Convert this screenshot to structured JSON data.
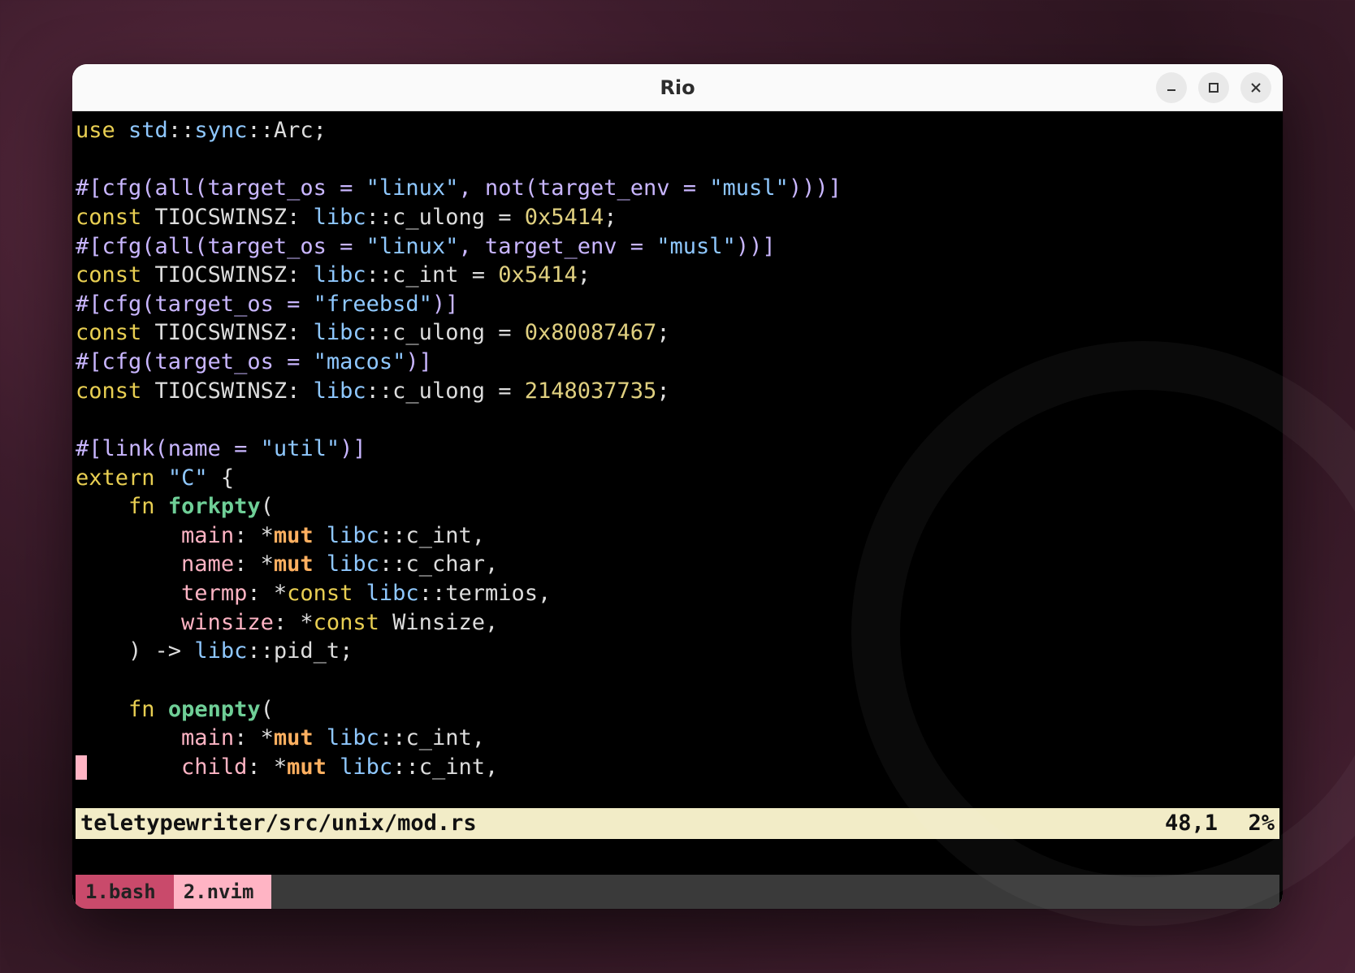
{
  "window": {
    "title": "Rio"
  },
  "status": {
    "file": "teletypewriter/src/unix/mod.rs",
    "pos": "48,1",
    "pct": "2%"
  },
  "tabs": [
    {
      "label": "1.bash",
      "active": false
    },
    {
      "label": "2.nvim",
      "active": true
    }
  ],
  "code": {
    "l1": {
      "use": "use",
      "path": "std",
      "sep1": "::",
      "sync": "sync",
      "sep2": "::",
      "arc": "Arc",
      "end": ";"
    },
    "l3": {
      "attr": "#[cfg(all(target_os = ",
      "s1": "\"linux\"",
      "mid": ", not(target_env = ",
      "s2": "\"musl\"",
      "tail": ")))]"
    },
    "l4": {
      "const": "const",
      "name": "TIOCSWINSZ",
      "colon": ": ",
      "libc": "libc",
      "sep": "::",
      "ty": "c_ulong",
      "eq": " = ",
      "val": "0x5414",
      "end": ";"
    },
    "l5": {
      "attr": "#[cfg(all(target_os = ",
      "s1": "\"linux\"",
      "mid": ", target_env = ",
      "s2": "\"musl\"",
      "tail": "))]"
    },
    "l6": {
      "const": "const",
      "name": "TIOCSWINSZ",
      "colon": ": ",
      "libc": "libc",
      "sep": "::",
      "ty": "c_int",
      "eq": " = ",
      "val": "0x5414",
      "end": ";"
    },
    "l7": {
      "attr": "#[cfg(target_os = ",
      "s1": "\"freebsd\"",
      "tail": ")]"
    },
    "l8": {
      "const": "const",
      "name": "TIOCSWINSZ",
      "colon": ": ",
      "libc": "libc",
      "sep": "::",
      "ty": "c_ulong",
      "eq": " = ",
      "val": "0x80087467",
      "end": ";"
    },
    "l9": {
      "attr": "#[cfg(target_os = ",
      "s1": "\"macos\"",
      "tail": ")]"
    },
    "l10": {
      "const": "const",
      "name": "TIOCSWINSZ",
      "colon": ": ",
      "libc": "libc",
      "sep": "::",
      "ty": "c_ulong",
      "eq": " = ",
      "val": "2148037735",
      "end": ";"
    },
    "l12": {
      "attr": "#[link(name = ",
      "s1": "\"util\"",
      "tail": ")]"
    },
    "l13": {
      "extern": "extern",
      "abi": "\"C\"",
      "brace": " {"
    },
    "l14": {
      "indent": "    ",
      "fn": "fn",
      "name": "forkpty",
      "paren": "("
    },
    "l15": {
      "indent": "        ",
      "arg": "main",
      "colon": ": ",
      "star": "*",
      "mut": "mut",
      "sp": " ",
      "libc": "libc",
      "sep": "::",
      "ty": "c_int",
      "end": ","
    },
    "l16": {
      "indent": "        ",
      "arg": "name",
      "colon": ": ",
      "star": "*",
      "mut": "mut",
      "sp": " ",
      "libc": "libc",
      "sep": "::",
      "ty": "c_char",
      "end": ","
    },
    "l17": {
      "indent": "        ",
      "arg": "termp",
      "colon": ": ",
      "star": "*",
      "const": "const",
      "sp": " ",
      "libc": "libc",
      "sep": "::",
      "ty": "termios",
      "end": ","
    },
    "l18": {
      "indent": "        ",
      "arg": "winsize",
      "colon": ": ",
      "star": "*",
      "const": "const",
      "sp": " ",
      "ty": "Winsize",
      "end": ","
    },
    "l19": {
      "indent": "    ",
      "close": ") -> ",
      "libc": "libc",
      "sep": "::",
      "ty": "pid_t",
      "end": ";"
    },
    "l21": {
      "indent": "    ",
      "fn": "fn",
      "name": "openpty",
      "paren": "("
    },
    "l22": {
      "indent": "        ",
      "arg": "main",
      "colon": ": ",
      "star": "*",
      "mut": "mut",
      "sp": " ",
      "libc": "libc",
      "sep": "::",
      "ty": "c_int",
      "end": ","
    },
    "l23": {
      "indent": "        ",
      "arg": "child",
      "colon": ": ",
      "star": "*",
      "mut": "mut",
      "sp": " ",
      "libc": "libc",
      "sep": "::",
      "ty": "c_int",
      "end": ","
    }
  }
}
